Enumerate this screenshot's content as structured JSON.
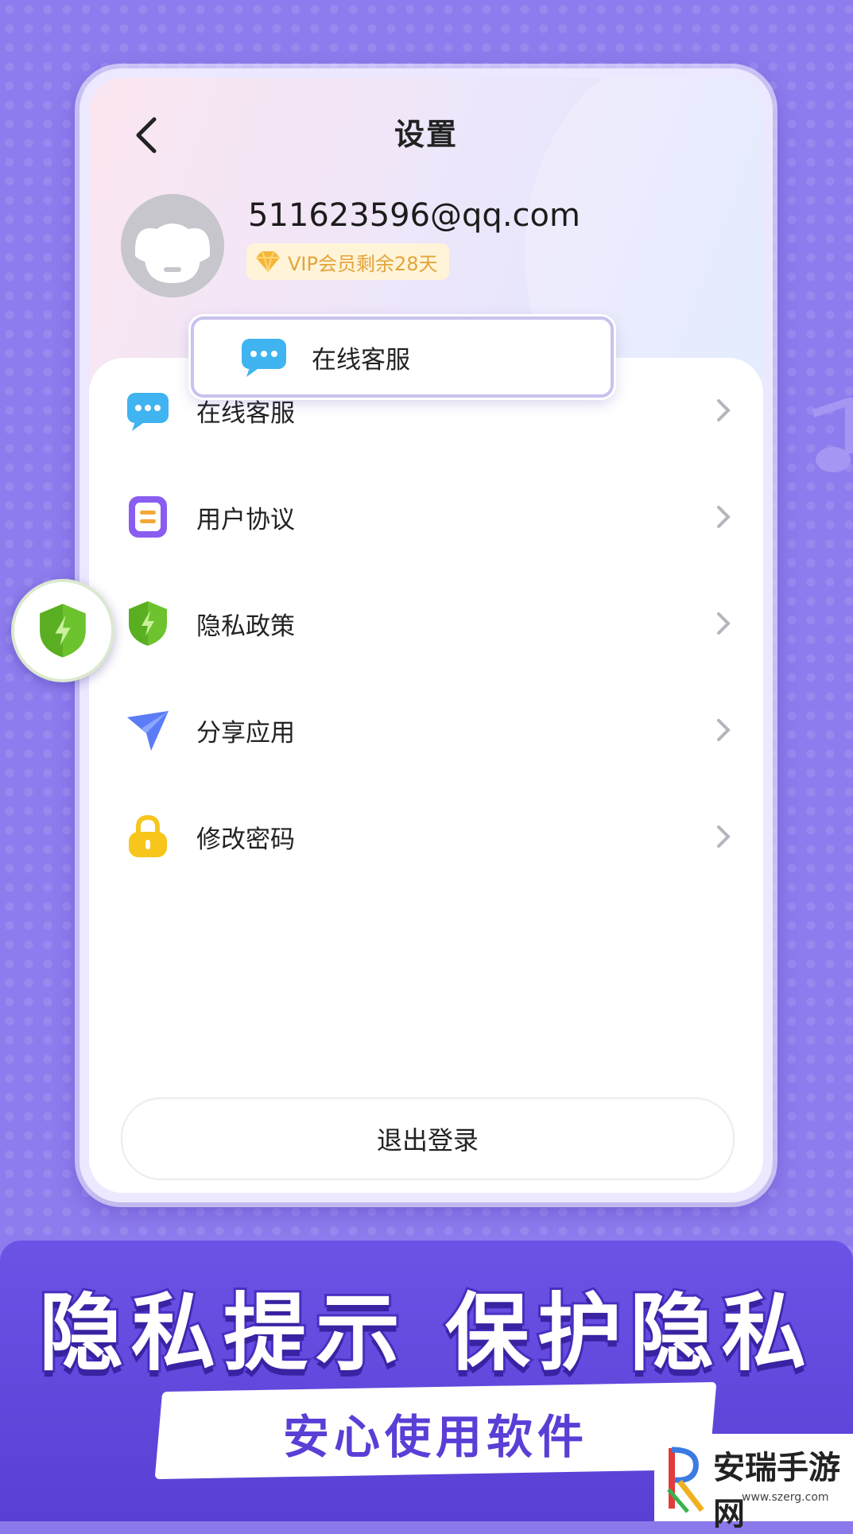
{
  "header": {
    "title": "设置"
  },
  "profile": {
    "email": "511623596@qq.com",
    "vip_text": "VIP会员剩余28天"
  },
  "highlight_popout": {
    "label": "在线客服"
  },
  "menu": [
    {
      "label": "在线客服",
      "icon": "chat-bubble-icon"
    },
    {
      "label": "用户协议",
      "icon": "document-icon"
    },
    {
      "label": "隐私政策",
      "icon": "shield-icon"
    },
    {
      "label": "分享应用",
      "icon": "send-plane-icon"
    },
    {
      "label": "修改密码",
      "icon": "lock-icon"
    }
  ],
  "logout_label": "退出登录",
  "banner": {
    "title": "隐私提示 保护隐私",
    "subtitle": "安心使用软件"
  },
  "watermark": {
    "name": "安瑞手游网",
    "url": "www.szerg.com"
  },
  "colors": {
    "background": "#8c7ced",
    "banner": "#5a3fd4",
    "vip_gold": "#e3a43a",
    "shield_green": "#6cc32e",
    "chat_blue": "#3fb4f0",
    "doc_purple": "#8a5cf0",
    "plane_blue": "#5b7cf5",
    "lock_yellow": "#f7c51c"
  }
}
